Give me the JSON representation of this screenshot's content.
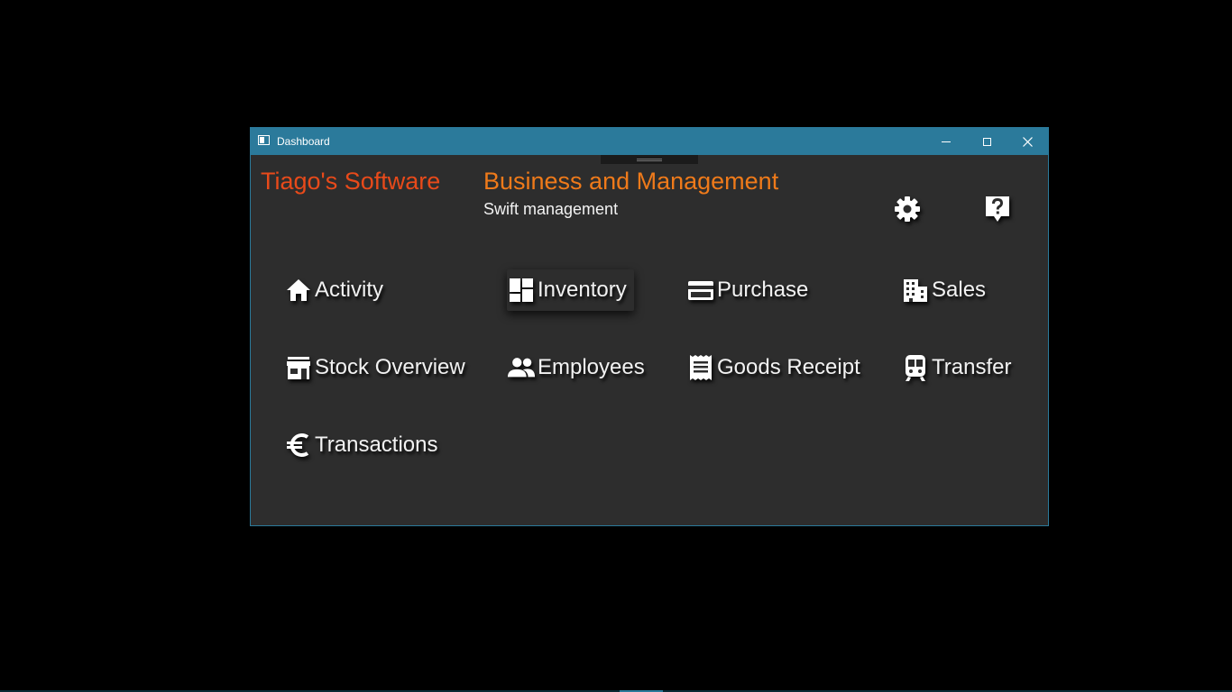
{
  "window": {
    "title": "Dashboard",
    "controls": {
      "minimize": "minimize",
      "maximize": "maximize",
      "close": "close"
    }
  },
  "header": {
    "brand": "Tiago's Software",
    "title": "Business and Management",
    "subtitle": "Swift management",
    "settings_icon": "gear-icon",
    "help_icon": "help-icon"
  },
  "tiles": [
    {
      "label": "Activity",
      "icon": "home-icon"
    },
    {
      "label": "Inventory",
      "icon": "dashboard-icon"
    },
    {
      "label": "Purchase",
      "icon": "credit-card-icon"
    },
    {
      "label": "Sales",
      "icon": "building-icon"
    },
    {
      "label": "Stock Overview",
      "icon": "store-icon"
    },
    {
      "label": "Employees",
      "icon": "people-icon"
    },
    {
      "label": "Goods Receipt",
      "icon": "receipt-icon"
    },
    {
      "label": "Transfer",
      "icon": "train-icon"
    },
    {
      "label": "Transactions",
      "icon": "euro-icon"
    }
  ],
  "colors": {
    "titlebar": "#2b7a9b",
    "window_bg": "#2d2d2d",
    "brand": "#e84a1a",
    "title": "#ef7a1a",
    "text": "#f2f2f2"
  }
}
